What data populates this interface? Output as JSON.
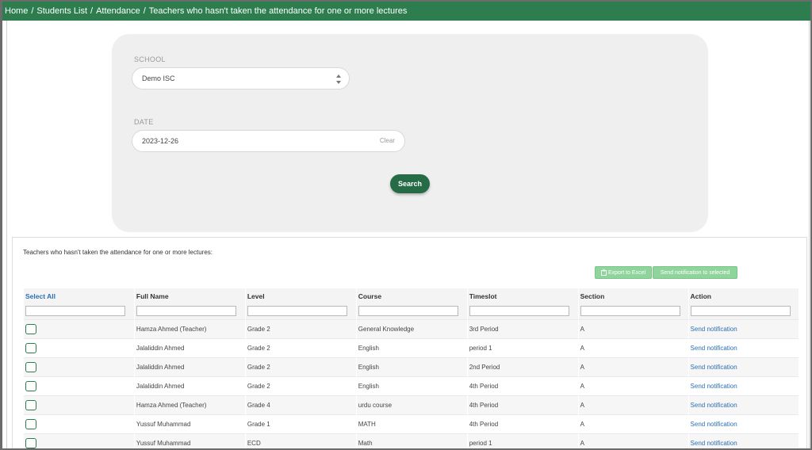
{
  "breadcrumb": {
    "items": [
      "Home",
      "Students List",
      "Attendance",
      "Teachers who hasn't taken the attendance for one or more lectures"
    ],
    "separator": "/"
  },
  "filters": {
    "school_label": "SCHOOL",
    "school_value": "Demo ISC",
    "date_label": "DATE",
    "date_value": "2023-12-26",
    "clear_label": "Clear",
    "search_label": "Search"
  },
  "results": {
    "title": "Teachers who hasn't taken the attendance for one or more lectures:",
    "export_label": "Export to Excel",
    "notify_selected_label": "Send notification to selected",
    "columns": [
      "Select All",
      "Full Name",
      "Level",
      "Course",
      "Timeslot",
      "Section",
      "Action"
    ],
    "rows": [
      {
        "name": "Hamza Ahmed (Teacher)",
        "level": "Grade 2",
        "course": "General Knowledge",
        "timeslot": "3rd Period",
        "section": "A",
        "action": "Send notification"
      },
      {
        "name": "Jalaliddin Ahmed",
        "level": "Grade 2",
        "course": "English",
        "timeslot": "period 1",
        "section": "A",
        "action": "Send notification"
      },
      {
        "name": "Jalaliddin Ahmed",
        "level": "Grade 2",
        "course": "English",
        "timeslot": "2nd Period",
        "section": "A",
        "action": "Send notification"
      },
      {
        "name": "Jalaliddin Ahmed",
        "level": "Grade 2",
        "course": "English",
        "timeslot": "4th Period",
        "section": "A",
        "action": "Send notification"
      },
      {
        "name": "Hamza Ahmed (Teacher)",
        "level": "Grade 4",
        "course": "urdu course",
        "timeslot": "4th Period",
        "section": "A",
        "action": "Send notification"
      },
      {
        "name": "Yussuf Muhammad",
        "level": "Grade 1",
        "course": "MATH",
        "timeslot": "4th Period",
        "section": "A",
        "action": "Send notification"
      },
      {
        "name": "Yussuf Muhammad",
        "level": "ECD",
        "course": "Math",
        "timeslot": "period 1",
        "section": "A",
        "action": "Send notification"
      }
    ]
  },
  "colors": {
    "brand_green": "#2e7d4f",
    "button_green": "#256b45",
    "light_green_button": "#8fd49a",
    "link_blue": "#2a6fb5"
  },
  "icons": {
    "export": "excel-icon",
    "select": "select-arrows-icon"
  }
}
